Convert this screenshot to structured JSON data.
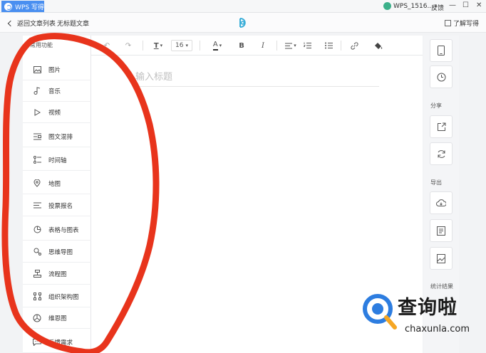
{
  "titlebar": {
    "app_name": "WPS 写得",
    "user": "WPS_1516...",
    "feedback": "反馈",
    "min": "—",
    "max": "☐",
    "close": "✕"
  },
  "nav": {
    "back_label": "返回文章列表",
    "doc_name": "无标题文章",
    "learn_label": "了解写得"
  },
  "left_panel": {
    "title": "常用功能",
    "tools": [
      {
        "label": "图片",
        "icon": "image-icon"
      },
      {
        "label": "音乐",
        "icon": "music-icon"
      },
      {
        "label": "视频",
        "icon": "video-icon"
      },
      {
        "label": "图文混排",
        "icon": "mixed-layout-icon"
      },
      {
        "label": "时间轴",
        "icon": "timeline-icon"
      },
      {
        "label": "地图",
        "icon": "map-pin-icon"
      },
      {
        "label": "投票报名",
        "icon": "vote-icon"
      },
      {
        "label": "表格与图表",
        "icon": "pie-chart-icon"
      },
      {
        "label": "思维导图",
        "icon": "mindmap-icon"
      },
      {
        "label": "流程图",
        "icon": "flowchart-icon"
      },
      {
        "label": "组织架构图",
        "icon": "org-chart-icon"
      },
      {
        "label": "维恩图",
        "icon": "venn-icon"
      },
      {
        "label": "反馈需求",
        "icon": "feedback-icon"
      }
    ]
  },
  "toolbar": {
    "undo": "↶",
    "redo": "↷",
    "heading": "T",
    "font_size": "16",
    "font_color": "A",
    "bold": "B",
    "italic": "I"
  },
  "editor": {
    "title_placeholder": "输入标题"
  },
  "right_panel": {
    "share_label": "分享",
    "export_label": "导出",
    "stats_label": "统计结果"
  },
  "watermark": {
    "brand": "查询啦",
    "url": "chaxunla.com"
  },
  "colors": {
    "accent": "#4a8ff0",
    "annotation": "#e8341c",
    "watermark_blue": "#2d7de0",
    "watermark_orange": "#f5a623"
  }
}
